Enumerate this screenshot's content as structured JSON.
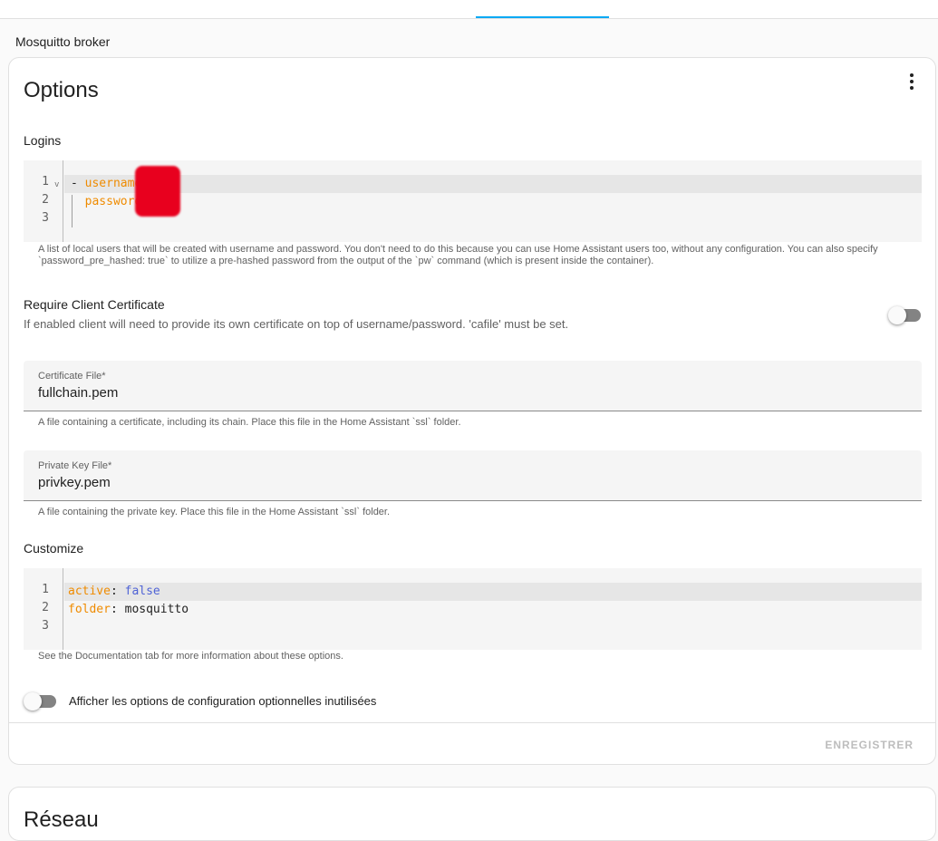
{
  "breadcrumb": "Mosquitto broker",
  "options_card": {
    "title": "Options",
    "menu_icon": "dots-vertical-icon",
    "logins": {
      "label": "Logins",
      "lines": [
        {
          "num": "1",
          "dash": "- ",
          "key": "username",
          "colon": ":"
        },
        {
          "num": "2",
          "dash": "  ",
          "key": "password",
          "colon": ":"
        },
        {
          "num": "3"
        }
      ],
      "fold_icon": "chevron-down-icon",
      "helper": "A list of local users that will be created with username and password. You don't need to do this because you can use Home Assistant users too, without any configuration. You can also specify `password_pre_hashed: true` to utilize a pre-hashed password from the output of the `pw` command (which is present inside the container)."
    },
    "require_cert": {
      "label": "Require Client Certificate",
      "description": "If enabled client will need to provide its own certificate on top of username/password. 'cafile' must be set.",
      "enabled": false
    },
    "certfile": {
      "label": "Certificate File*",
      "value": "fullchain.pem",
      "helper": "A file containing a certificate, including its chain. Place this file in the Home Assistant `ssl` folder."
    },
    "keyfile": {
      "label": "Private Key File*",
      "value": "privkey.pem",
      "helper": "A file containing the private key. Place this file in the Home Assistant `ssl` folder."
    },
    "customize": {
      "label": "Customize",
      "lines": [
        {
          "num": "1",
          "key": "active",
          "colon": ": ",
          "value": "false"
        },
        {
          "num": "2",
          "key": "folder",
          "colon": ": ",
          "value": "mosquitto"
        },
        {
          "num": "3"
        }
      ],
      "helper": "See the Documentation tab for more information about these options."
    },
    "show_unused": {
      "label": "Afficher les options de configuration optionnelles inutilisées",
      "enabled": false
    },
    "save_label": "ENREGISTRER"
  },
  "network_card": {
    "title": "Réseau"
  },
  "colors": {
    "accent": "#03a9f4",
    "yaml_key": "#ef8b00",
    "yaml_bool": "#4f63d6",
    "redaction": "#e8001e"
  }
}
